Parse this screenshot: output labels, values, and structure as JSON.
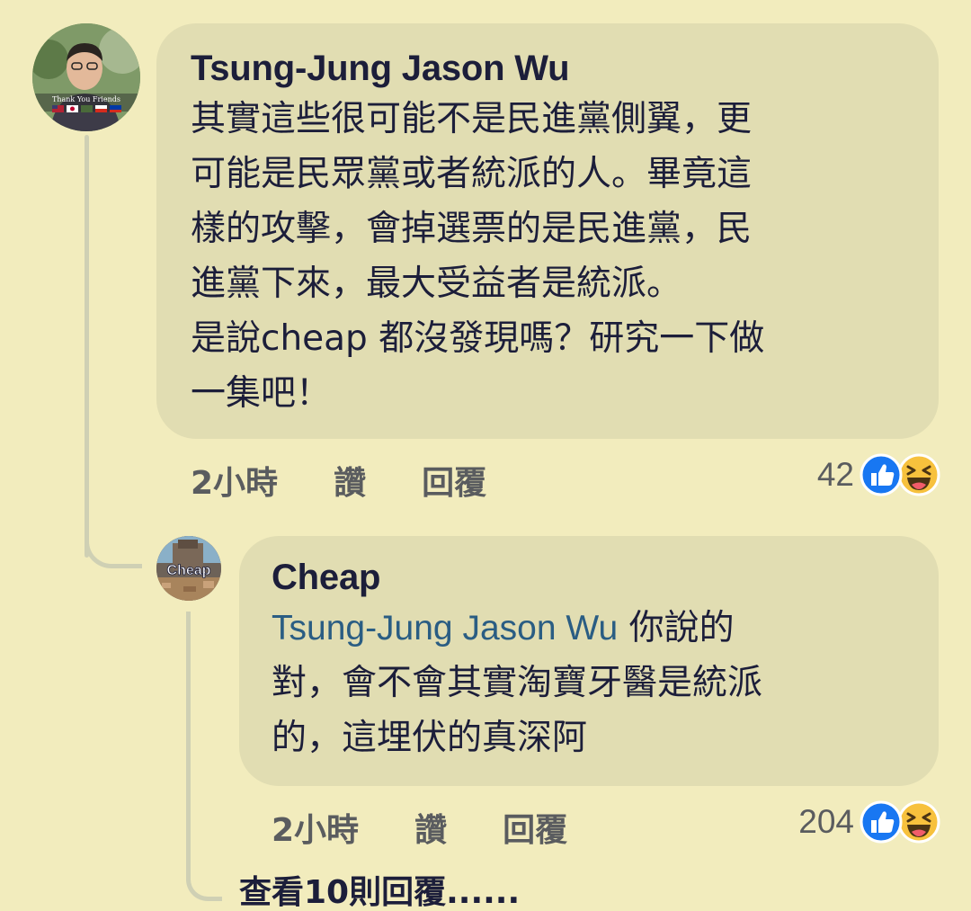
{
  "comment": {
    "author": "Tsung-Jung Jason Wu",
    "avatar_caption": "Thank You Friends",
    "lines": [
      "其實這些很可能不是民進黨側翼，更",
      "可能是民眾黨或者統派的人。畢竟這",
      "樣的攻擊，會掉選票的是民進黨，民",
      "進黨下來，最大受益者是統派。",
      "是說cheap 都沒發現嗎？研究一下做",
      "一集吧！"
    ],
    "time": "2小時",
    "like_label": "讚",
    "reply_label": "回覆",
    "reaction_count": "42",
    "reaction_icons": [
      "like-icon",
      "haha-icon"
    ]
  },
  "reply": {
    "author": "Cheap",
    "avatar_caption": "Cheap",
    "mention": "Tsung-Jung Jason Wu",
    "line1_rest": " 你說的",
    "lines": [
      "對，會不會其實淘寶牙醫是統派",
      "的，這埋伏的真深阿"
    ],
    "time": "2小時",
    "like_label": "讚",
    "reply_label": "回覆",
    "reaction_count": "204",
    "reaction_icons": [
      "like-icon",
      "haha-icon"
    ]
  },
  "view_more_replies": "查看10則回覆......",
  "colors": {
    "background": "#f2ecbd",
    "bubble": "#e1ddb2",
    "text": "#1c1e3a",
    "mention": "#2a5d83",
    "meta": "#5a5c5f",
    "like_blue": "#1877f2",
    "haha_yellow": "#f7c13d"
  }
}
